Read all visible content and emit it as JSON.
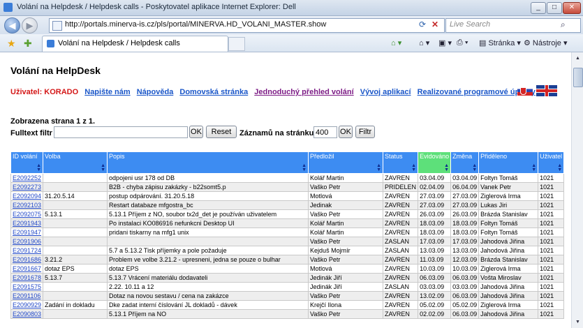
{
  "window": {
    "title": "Volání na Helpdesk / Helpdesk calls - Poskytovatel aplikace Internet Explorer: Dell",
    "url": "http://portals.minerva-is.cz/pls/portal/MINERVA.HD_VOLANI_MASTER.show",
    "search_placeholder": "Live Search",
    "tab_title": "Volání na Helpdesk / Helpdesk calls",
    "toolbar_page": "Stránka",
    "toolbar_tools": "Nástroje"
  },
  "page": {
    "heading": "Volání na HelpDesk",
    "user_label": "Uživatel: KORADO",
    "nav_links": [
      "Napište nám",
      "Nápověda",
      "Domovská stránka",
      "Jednoduchý přehled volání",
      "Vývoj aplikací",
      "Realizované programové úpravy"
    ],
    "page_info": "Zobrazena strana 1 z 1.",
    "fulltext_label": "Fulltext filtr",
    "fulltext_value": "",
    "ok_label": "OK",
    "reset_label": "Reset",
    "records_label": "Záznamů na stránku",
    "records_value": "400",
    "ok2_label": "OK",
    "filter_label": "Filtr"
  },
  "table": {
    "columns": [
      "ID volání",
      "Volba",
      "Popis",
      "Předložil",
      "Status",
      "Evidováno",
      "Změna",
      "Přiděleno",
      "Uživatel"
    ],
    "rows": [
      [
        "E2092252",
        "",
        "odpojeni usr 178 od DB",
        "Kolář Martin",
        "ZAVREN",
        "03.04.09",
        "03.04.09",
        "Foltyn Tomáš",
        "1021"
      ],
      [
        "E2092273",
        "",
        "B2B - chyba zápisu zakázky - b22somt5.p",
        "Vaško Petr",
        "PRIDELEN",
        "02.04.09",
        "06.04.09",
        "Vanek Petr",
        "1021"
      ],
      [
        "E2092094",
        "31.20.5.14",
        "postup odpárování. 31.20.5.18",
        "Motlová",
        "ZAVREN",
        "27.03.09",
        "27.03.09",
        "Ziglerová Irma",
        "1021"
      ],
      [
        "E2092103",
        "",
        "Restart databaze mfgostra_bc",
        "Jedinak",
        "ZAVREN",
        "27.03.09",
        "27.03.09",
        "Lukas Jiri",
        "1021"
      ],
      [
        "E2092075",
        "5.13.1",
        "5.13.1 Příjem z NO, soubor tx2d_det je používán uživatelem",
        "Vaško Petr",
        "ZAVREN",
        "26.03.09",
        "26.03.09",
        "Brázda Stanislav",
        "1021"
      ],
      [
        "E2091943",
        "",
        "Po instalaci KO086916 nefunkcni Desktop UI",
        "Kolář Martin",
        "ZAVREN",
        "18.03.09",
        "18.03.09",
        "Foltyn Tomáš",
        "1021"
      ],
      [
        "E2091947",
        "",
        "pridani tiskarny na mfg1 unix",
        "Kolář Martin",
        "ZAVREN",
        "18.03.09",
        "18.03.09",
        "Foltyn Tomáš",
        "1021"
      ],
      [
        "E2091906",
        "",
        "",
        "Vaško Petr",
        "ZASLAN",
        "17.03.09",
        "17.03.09",
        "Jahodová Jiřina",
        "1021"
      ],
      [
        "E2091724",
        "",
        "5.7 a 5.13.2 Tisk příjemky a pole požaduje",
        "Kejduš Mojmír",
        "ZASLAN",
        "13.03.09",
        "13.03.09",
        "Jahodová Jiřina",
        "1021"
      ],
      [
        "E2091686",
        "3.21.2",
        "Problem ve volbe 3.21.2 - upresneni, jedna se pouze o bulhar",
        "Vaško Petr",
        "ZAVREN",
        "11.03.09",
        "12.03.09",
        "Brázda Stanislav",
        "1021"
      ],
      [
        "E2091667",
        "dotaz EPS",
        "dotaz EPS",
        "Motlová",
        "ZAVREN",
        "10.03.09",
        "10.03.09",
        "Ziglerová Irma",
        "1021"
      ],
      [
        "E2091678",
        "5.13.7",
        "5.13.7 Vrácení materiálu dodavateli",
        "Jedinák Jiří",
        "ZAVREN",
        "06.03.09",
        "06.03.09",
        "Vošta Miroslav",
        "1021"
      ],
      [
        "E2091575",
        "",
        "2.22. 10.11 a 12",
        "Jedinák Jiří",
        "ZASLAN",
        "03.03.09",
        "03.03.09",
        "Jahodová Jiřina",
        "1021"
      ],
      [
        "E2091106",
        "",
        "Dotaz na novou sestavu / cena na zakázce",
        "Vaško Petr",
        "ZAVREN",
        "13.02.09",
        "06.03.09",
        "Jahodová Jiřina",
        "1021"
      ],
      [
        "E2090929",
        "Zadání in dokladu",
        "Dke zadat interní číslování JL dokladů - dávek",
        "Krejčí Ilona",
        "ZAVREN",
        "05.02.09",
        "05.02.09",
        "Ziglerová Irma",
        "1021"
      ],
      [
        "E2090803",
        "",
        "5.13.1 Příjem na NO",
        "Vaško Petr",
        "ZAVREN",
        "02.02.09",
        "06.03.09",
        "Jahodová Jiřina",
        "1021"
      ]
    ]
  }
}
